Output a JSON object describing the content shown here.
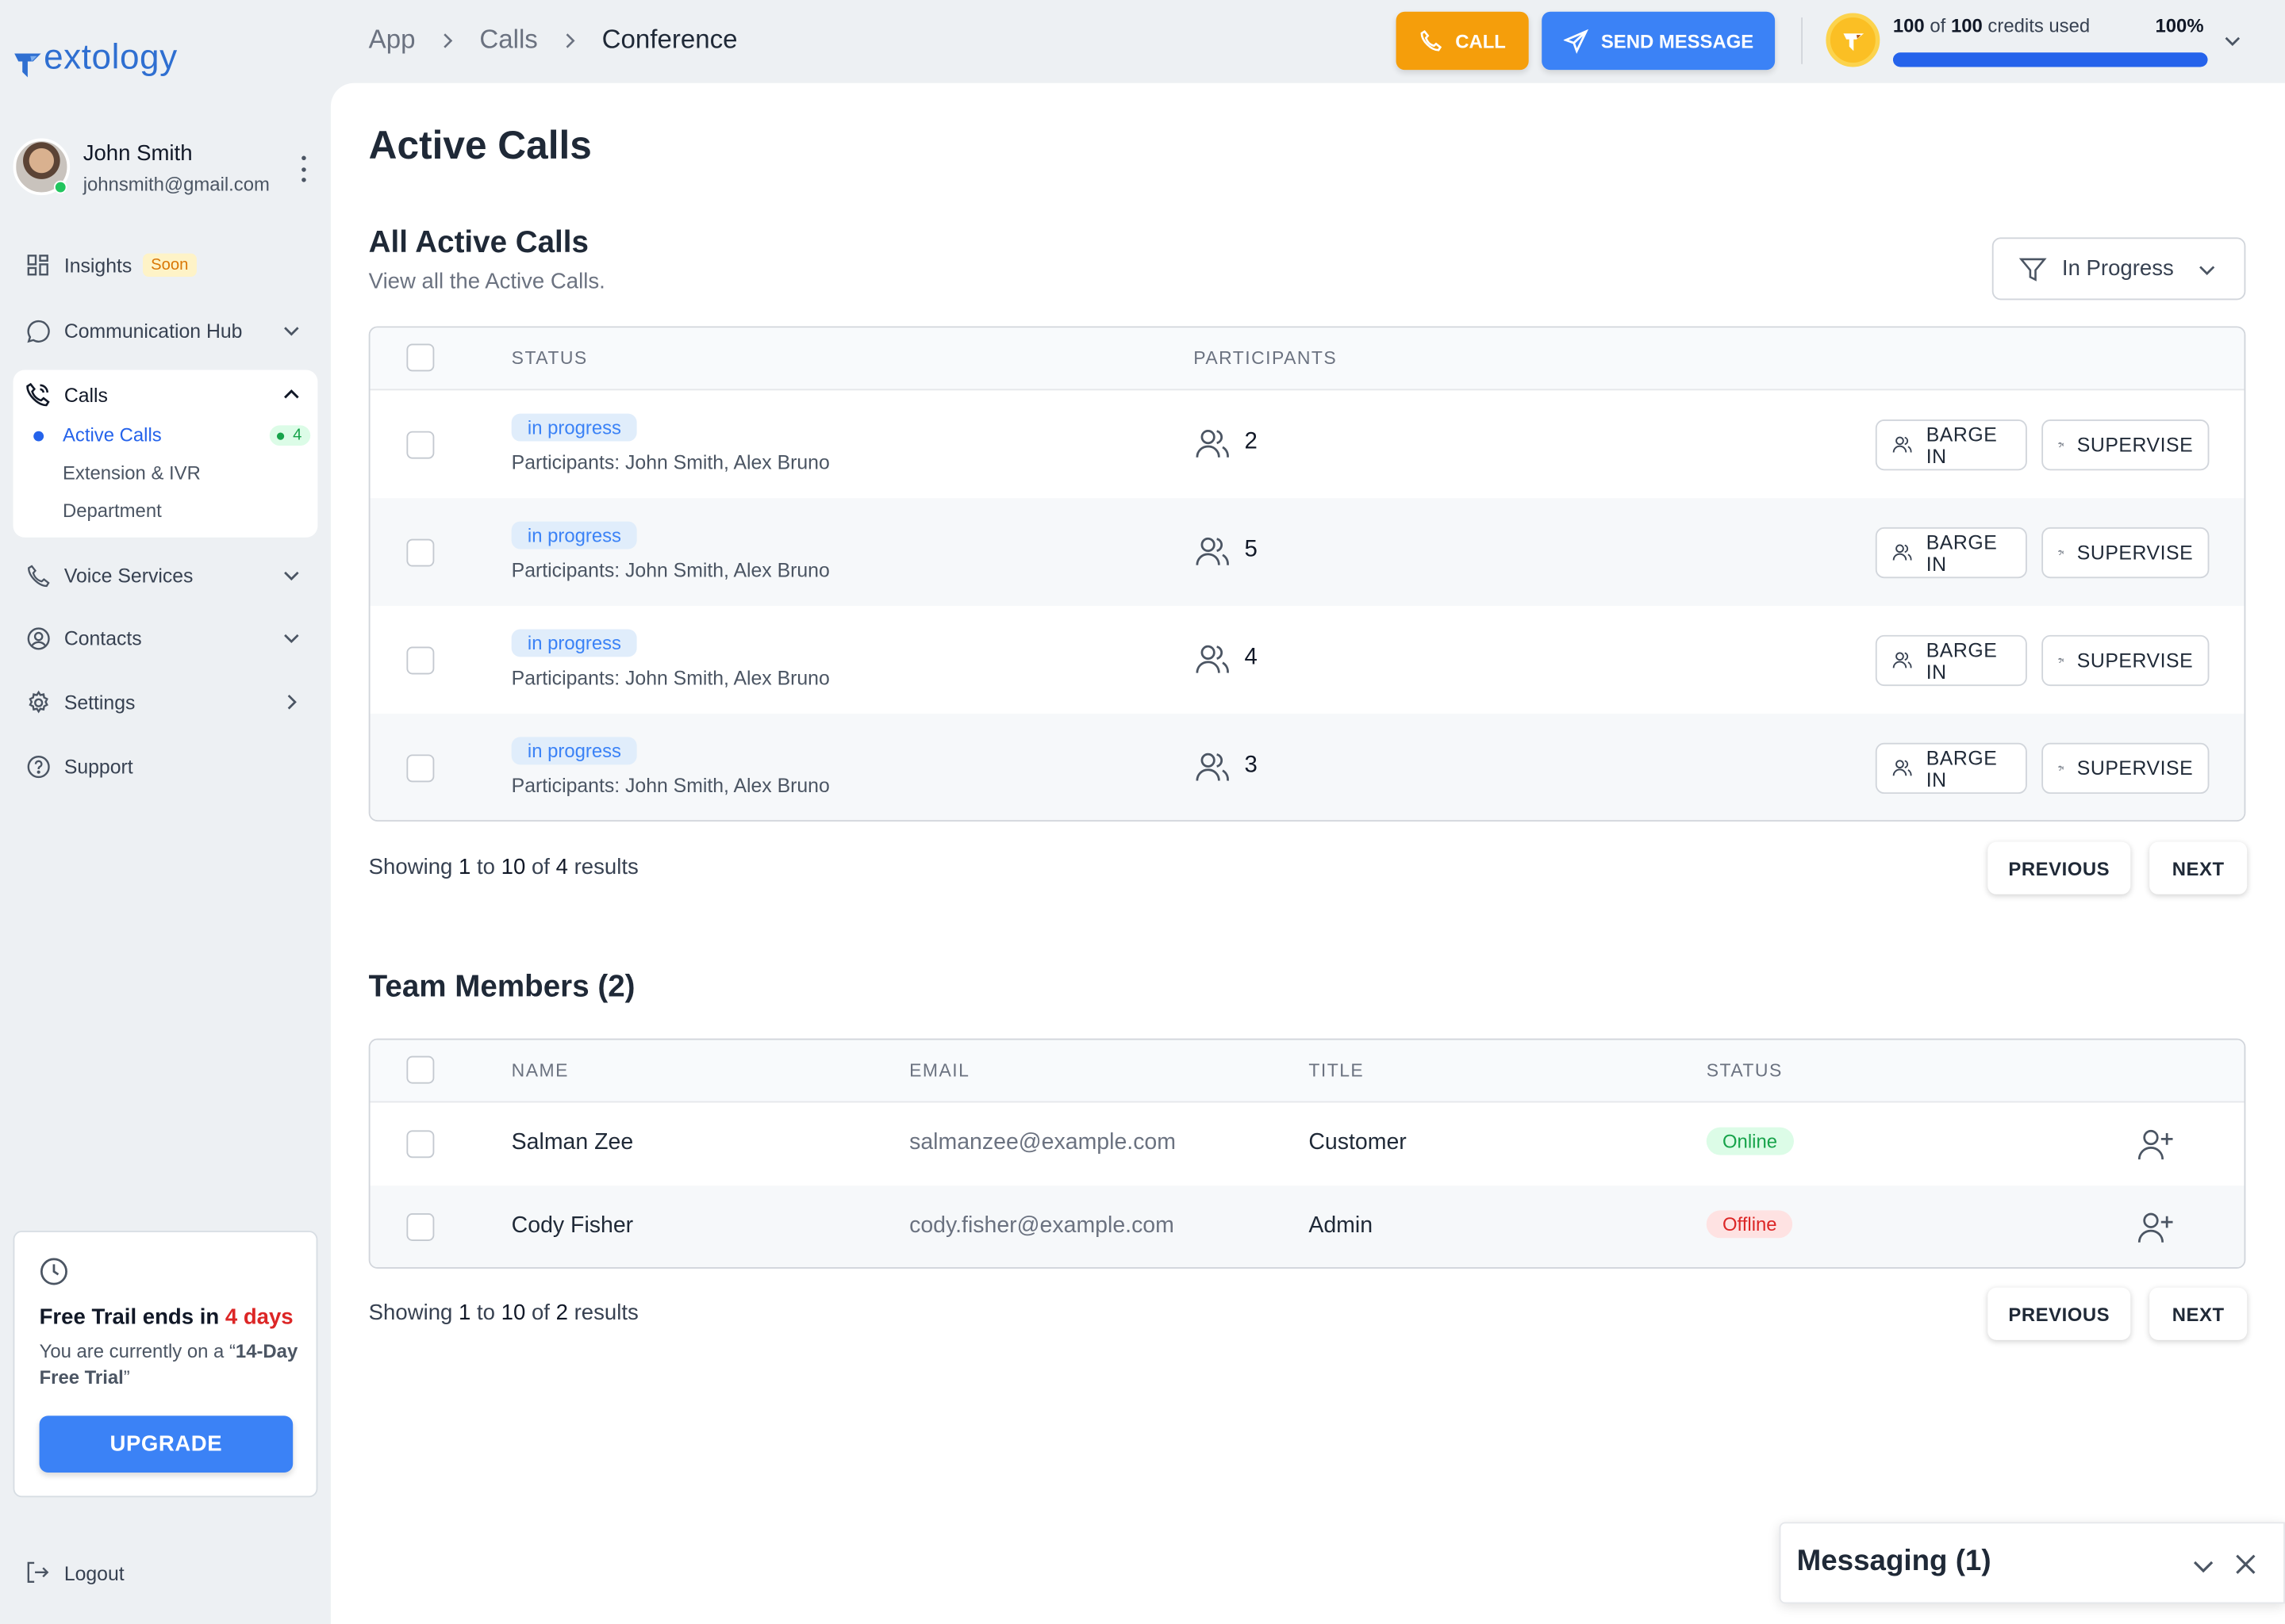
{
  "brand": {
    "logo_text": "extology",
    "color": "#2f6fd1"
  },
  "user": {
    "name": "John Smith",
    "email": "johnsmith@gmail.com",
    "status": "online"
  },
  "nav": {
    "insights": {
      "label": "Insights",
      "badge": "Soon",
      "icon": "grid-icon"
    },
    "communication_hub": {
      "label": "Communication Hub",
      "icon": "chat-bubble-icon"
    },
    "calls": {
      "label": "Calls",
      "icon": "phone-call-icon",
      "items": [
        {
          "label": "Active Calls",
          "count": "4",
          "active": true
        },
        {
          "label": "Extension & IVR"
        },
        {
          "label": "Department"
        }
      ]
    },
    "voice_services": {
      "label": "Voice Services",
      "icon": "phone-icon"
    },
    "contacts": {
      "label": "Contacts",
      "icon": "user-circle-icon"
    },
    "settings": {
      "label": "Settings",
      "icon": "gear-icon"
    },
    "support": {
      "label": "Support",
      "icon": "question-circle-icon"
    },
    "logout": {
      "label": "Logout",
      "icon": "logout-icon"
    }
  },
  "trial": {
    "title_prefix": "Free Trail ends in ",
    "days": "4 days",
    "desc_prefix": "You are currently on a “",
    "plan": "14-Day Free Trial",
    "desc_suffix": "”",
    "upgrade_label": "UPGRADE"
  },
  "breadcrumb": [
    "App",
    "Calls",
    "Conference"
  ],
  "topbar": {
    "call_label": "CALL",
    "send_message_label": "SEND MESSAGE",
    "credits_used": "100",
    "credits_total": "100",
    "credits_text_of": " of ",
    "credits_text_suffix": " credits used",
    "credits_percent": "100%",
    "credits_fraction": 1.0,
    "colors": {
      "call": "#f59e0b",
      "message": "#3b82f6"
    }
  },
  "page": {
    "title": "Active Calls",
    "active_calls": {
      "title": "All Active Calls",
      "subtitle": "View all the Active Calls.",
      "filter_value": "In Progress",
      "columns": [
        "STATUS",
        "PARTICIPANTS"
      ],
      "rows": [
        {
          "status": "in progress",
          "participants_text": "Participants: John Smith, Alex Bruno",
          "count": "2"
        },
        {
          "status": "in progress",
          "participants_text": "Participants: John Smith, Alex Bruno",
          "count": "5"
        },
        {
          "status": "in progress",
          "participants_text": "Participants: John Smith, Alex Bruno",
          "count": "4"
        },
        {
          "status": "in progress",
          "participants_text": "Participants: John Smith, Alex Bruno",
          "count": "3"
        }
      ],
      "barge_label": "BARGE IN",
      "supervise_label": "SUPERVISE",
      "showing": {
        "prefix": "Showing ",
        "from": "1",
        "to_word": " to ",
        "to": "10",
        "of_word": " of ",
        "total": "4",
        "suffix": " results"
      },
      "previous_label": "PREVIOUS",
      "next_label": "NEXT"
    },
    "team": {
      "title": "Team Members (2)",
      "columns": [
        "NAME",
        "EMAIL",
        "TITLE",
        "STATUS"
      ],
      "rows": [
        {
          "name": "Salman Zee",
          "email": "salmanzee@example.com",
          "title": "Customer",
          "status": "Online"
        },
        {
          "name": "Cody Fisher",
          "email": "cody.fisher@example.com",
          "title": "Admin",
          "status": "Offline"
        }
      ],
      "showing": {
        "prefix": "Showing ",
        "from": "1",
        "to_word": " to ",
        "to": "10",
        "of_word": " of ",
        "total": "2",
        "suffix": " results"
      },
      "previous_label": "PREVIOUS",
      "next_label": "NEXT"
    }
  },
  "messaging": {
    "title": "Messaging (1)"
  }
}
